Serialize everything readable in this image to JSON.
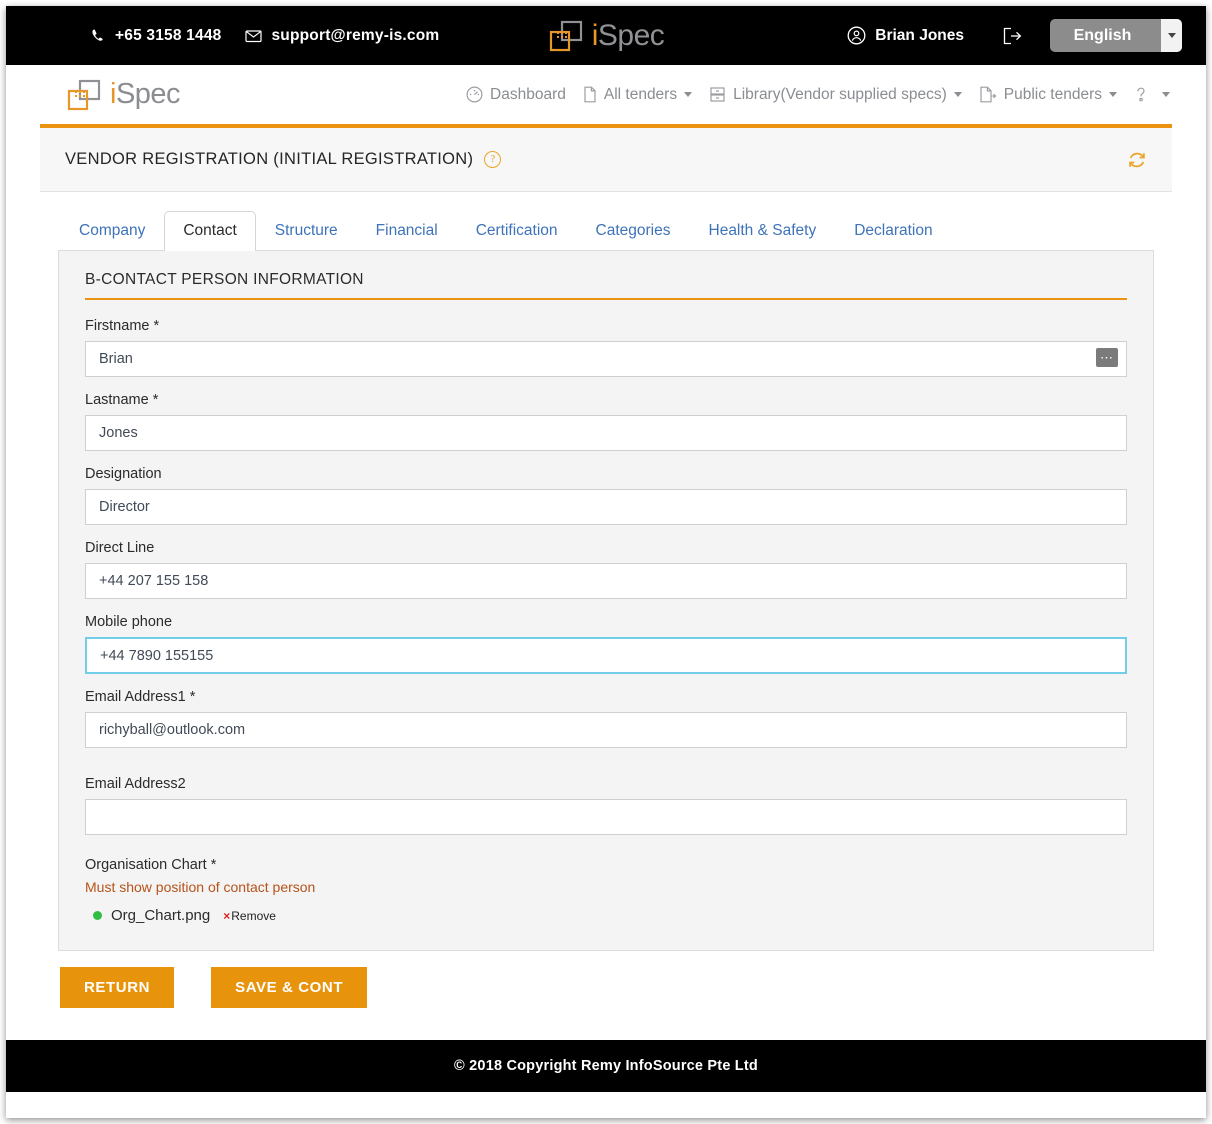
{
  "topbar": {
    "phone": "+65 3158 1448",
    "email": "support@remy-is.com",
    "brand_i": "i",
    "brand_spec": "Spec",
    "user_name": "Brian Jones",
    "language": "English",
    "phone_icon": "phone-icon",
    "mail_icon": "mail-icon",
    "user_icon": "user-circle-icon",
    "logout_icon": "logout-icon",
    "caret_icon": "caret-down-icon"
  },
  "navbar": {
    "brand_i": "i",
    "brand_spec": "Spec",
    "items": [
      {
        "label": "Dashboard",
        "icon": "dashboard-gauge-icon",
        "has_caret": false
      },
      {
        "label": "All tenders",
        "icon": "document-icon",
        "has_caret": true
      },
      {
        "label": "Library(Vendor supplied specs)",
        "icon": "library-drawer-icon",
        "has_caret": true
      },
      {
        "label": "Public tenders",
        "icon": "document-arrow-icon",
        "has_caret": true
      },
      {
        "label": "",
        "icon": "question-mark-icon",
        "has_caret": true
      }
    ]
  },
  "page_header": {
    "title": "VENDOR REGISTRATION (INITIAL REGISTRATION)",
    "help_glyph": "?",
    "refresh_icon": "refresh-icon",
    "accent_color": "#eb9311"
  },
  "tabs": [
    {
      "label": "Company",
      "active": false
    },
    {
      "label": "Contact",
      "active": true
    },
    {
      "label": "Structure",
      "active": false
    },
    {
      "label": "Financial",
      "active": false
    },
    {
      "label": "Certification",
      "active": false
    },
    {
      "label": "Categories",
      "active": false
    },
    {
      "label": "Health & Safety",
      "active": false
    },
    {
      "label": "Declaration",
      "active": false
    }
  ],
  "form": {
    "section_title": "B-CONTACT PERSON INFORMATION",
    "fields": {
      "firstname": {
        "label": "Firstname *",
        "value": "Brian",
        "placeholder": ""
      },
      "lastname": {
        "label": "Lastname *",
        "value": "Jones",
        "placeholder": ""
      },
      "designation": {
        "label": "Designation",
        "value": "Director",
        "placeholder": ""
      },
      "direct_line": {
        "label": "Direct Line",
        "value": "+44 207 155 158",
        "placeholder": ""
      },
      "mobile_phone": {
        "label": "Mobile phone",
        "value": "+44 7890 155155",
        "placeholder": ""
      },
      "email1": {
        "label": "Email Address1 *",
        "value": "richyball@outlook.com",
        "placeholder": ""
      },
      "email2": {
        "label": "Email Address2",
        "value": "",
        "placeholder": ""
      }
    },
    "upload": {
      "label": "Organisation Chart *",
      "hint": "Must show position of contact person",
      "file_name": "Org_Chart.png",
      "remove_label": "Remove",
      "remove_x": "×",
      "dot_color": "#33bb44"
    }
  },
  "actions": {
    "return_label": "RETURN",
    "save_label": "SAVE & CONT",
    "button_color": "#e8930c"
  },
  "footer": {
    "copyright": "© 2018 Copyright  Remy InfoSource Pte Ltd"
  }
}
